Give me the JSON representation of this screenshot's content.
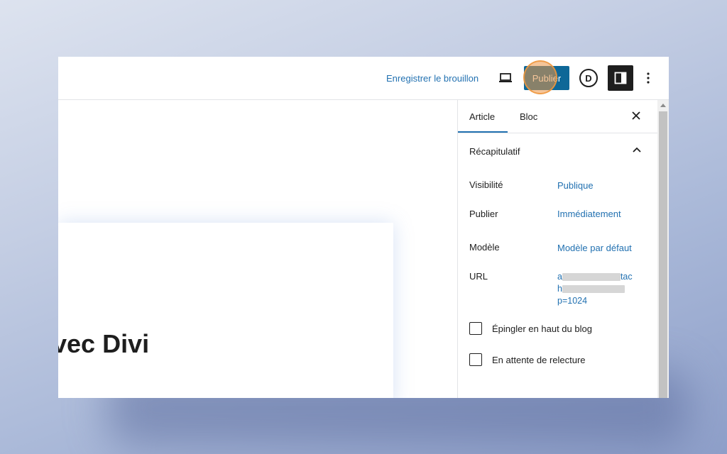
{
  "header": {
    "save_draft_label": "Enregistrer le brouillon",
    "preview_icon": "laptop-icon",
    "publish_label": "Publier",
    "divi_icon_letter": "D",
    "settings_icon": "sidebar-toggle-icon",
    "more_icon": "vertical-ellipsis-icon"
  },
  "editor": {
    "title_visible": "vec Divi"
  },
  "sidebar": {
    "tabs": [
      {
        "label": "Article",
        "active": true
      },
      {
        "label": "Bloc",
        "active": false
      }
    ],
    "close_icon": "close-icon",
    "summary": {
      "title": "Récapitulatif",
      "collapse_icon": "chevron-up-icon",
      "rows": [
        {
          "label": "Visibilité",
          "value": "Publique"
        },
        {
          "label": "Publier",
          "value": "Immédiatement"
        },
        {
          "label": "Modèle",
          "value": "Modèle par défaut"
        }
      ],
      "url": {
        "label": "URL",
        "line1_start": "a",
        "line1_end": "tac",
        "line2_start": "h",
        "line3": "p=1024"
      },
      "checkboxes": [
        {
          "label": "Épingler en haut du blog",
          "checked": false
        },
        {
          "label": "En attente de relecture",
          "checked": false
        }
      ]
    }
  },
  "colors": {
    "accent": "#2271b1",
    "publish_bg": "#0e6898",
    "highlight": "#ec9646",
    "text": "#1e1e1e"
  }
}
